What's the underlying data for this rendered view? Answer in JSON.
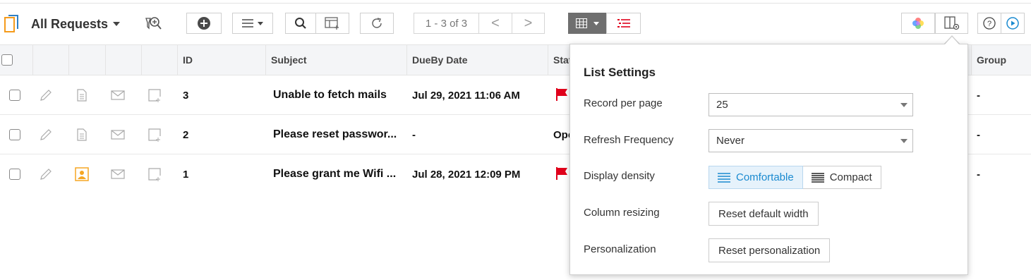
{
  "toolbar": {
    "view_title": "All Requests",
    "pagination": "1 - 3 of 3",
    "prev_symbol": "<",
    "next_symbol": ">"
  },
  "table": {
    "headers": [
      "ID",
      "Subject",
      "DueBy Date",
      "Stat",
      "Group"
    ],
    "rows": [
      {
        "id": "3",
        "subject": "Unable to fetch mails",
        "due": "Jul 29, 2021 11:06 AM",
        "status": "flag",
        "group": "-"
      },
      {
        "id": "2",
        "subject": "Please reset passwor...",
        "due": "-",
        "status": "Ope",
        "group": "-"
      },
      {
        "id": "1",
        "subject": "Please grant me Wifi ...",
        "due": "Jul 28, 2021 12:09 PM",
        "status": "flag",
        "group": "-"
      }
    ]
  },
  "list_settings": {
    "title": "List Settings",
    "record_per_page_label": "Record per page",
    "record_per_page_value": "25",
    "refresh_label": "Refresh Frequency",
    "refresh_value": "Never",
    "density_label": "Display density",
    "density_comfortable": "Comfortable",
    "density_compact": "Compact",
    "resize_label": "Column resizing",
    "resize_button": "Reset default width",
    "personalization_label": "Personalization",
    "personalization_button": "Reset personalization"
  },
  "colors": {
    "accent": "#1a8ad0",
    "flag_red": "#e0001b",
    "requester_orange": "#f5a623",
    "grid_button_bg": "#6f6f6f"
  }
}
